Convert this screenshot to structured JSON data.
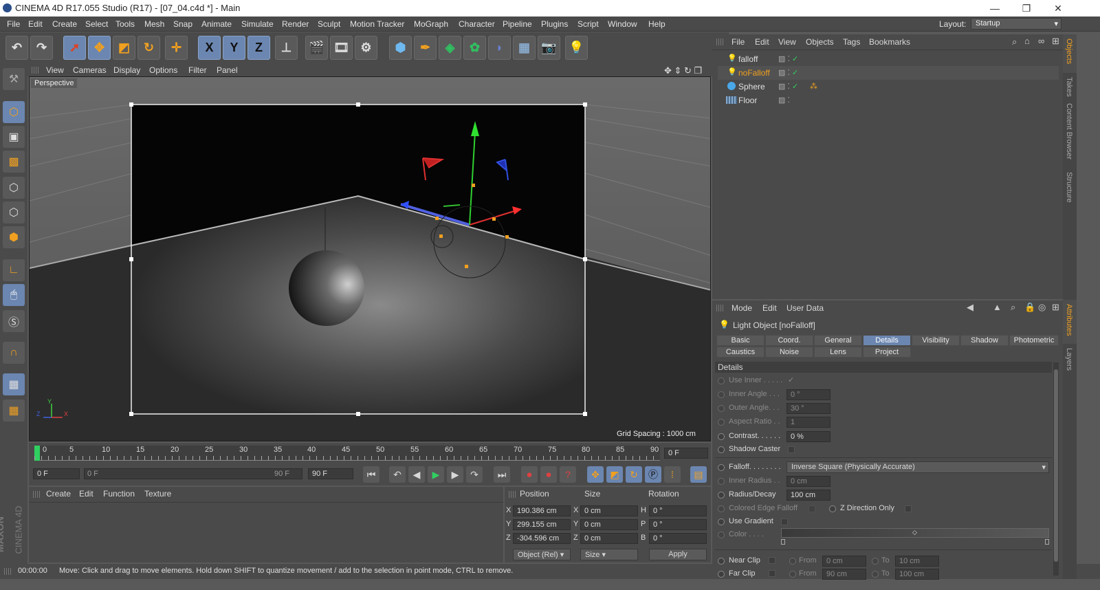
{
  "window": {
    "title": "CINEMA 4D R17.055 Studio (R17) - [07_04.c4d *] - Main",
    "min": "—",
    "restore": "❐",
    "close": "✕"
  },
  "menubar": [
    "File",
    "Edit",
    "Create",
    "Select",
    "Tools",
    "Mesh",
    "Snap",
    "Animate",
    "Simulate",
    "Render",
    "Sculpt",
    "Motion Tracker",
    "MoGraph",
    "Character",
    "Pipeline",
    "Plugins",
    "Script",
    "Window",
    "Help"
  ],
  "layout": {
    "label": "Layout:",
    "value": "Startup"
  },
  "toolbar": {
    "x_label": "X",
    "y_label": "Y",
    "z_label": "Z"
  },
  "viewport": {
    "menu": [
      "View",
      "Cameras",
      "Display",
      "Options",
      "Filter",
      "Panel"
    ],
    "name": "Perspective",
    "grid_spacing": "Grid Spacing : 1000 cm",
    "axes": {
      "x": "X",
      "y": "Y",
      "z": "Z"
    }
  },
  "timeline": {
    "ticks": [
      "0",
      "5",
      "10",
      "15",
      "20",
      "25",
      "30",
      "35",
      "40",
      "45",
      "50",
      "55",
      "60",
      "65",
      "70",
      "75",
      "80",
      "85",
      "90"
    ],
    "current_frame": "0 F",
    "start": "0 F",
    "slider_start": "0 F",
    "slider_end": "90 F",
    "end": "90 F"
  },
  "material_manager": {
    "menu": [
      "Create",
      "Edit",
      "Function",
      "Texture"
    ]
  },
  "coordinates": {
    "headers": {
      "position": "Position",
      "size": "Size",
      "rotation": "Rotation"
    },
    "rows": [
      {
        "axis": "X",
        "pos": "190.386 cm",
        "saxis": "X",
        "size": "0 cm",
        "raxis": "H",
        "rot": "0 °"
      },
      {
        "axis": "Y",
        "pos": "299.155 cm",
        "saxis": "Y",
        "size": "0 cm",
        "raxis": "P",
        "rot": "0 °"
      },
      {
        "axis": "Z",
        "pos": "-304.596 cm",
        "saxis": "Z",
        "size": "0 cm",
        "raxis": "B",
        "rot": "0 °"
      }
    ],
    "mode": "Object (Rel)",
    "size_mode": "Size",
    "apply": "Apply"
  },
  "status": {
    "time": "00:00:00",
    "message": "Move: Click and drag to move elements. Hold down SHIFT to quantize movement / add to the selection in point mode, CTRL to remove."
  },
  "branding": {
    "line1": "MAXON",
    "line2": "CINEMA 4D"
  },
  "object_manager": {
    "menu": [
      "File",
      "Edit",
      "View",
      "Objects",
      "Tags",
      "Bookmarks"
    ],
    "objects": [
      {
        "name": "falloff",
        "color": "#e0e0e0"
      },
      {
        "name": "noFalloff",
        "color": "#f0a020"
      },
      {
        "name": "Sphere",
        "color": "#e0e0e0"
      },
      {
        "name": "Floor",
        "color": "#e0e0e0"
      }
    ]
  },
  "right_tabs": {
    "objects": "Objects",
    "takes": "Takes",
    "content": "Content Browser",
    "structure": "Structure",
    "attributes": "Attributes",
    "layers": "Layers"
  },
  "attributes": {
    "menu": [
      "Mode",
      "Edit",
      "User Data"
    ],
    "object_title": "Light Object [noFalloff]",
    "tabs_row1": [
      "Basic",
      "Coord.",
      "General",
      "Details",
      "Visibility",
      "Shadow",
      "Photometric"
    ],
    "tabs_row2": [
      "Caustics",
      "Noise",
      "Lens",
      "Project"
    ],
    "section": "Details",
    "fields": {
      "use_inner": "Use Inner . . . . .",
      "use_inner_val": "✓",
      "inner_angle": "Inner Angle . . .",
      "inner_angle_val": "0 °",
      "outer_angle": "Outer Angle. . .",
      "outer_angle_val": "30 °",
      "aspect_ratio": "Aspect Ratio . .",
      "aspect_ratio_val": "1",
      "contrast": "Contrast. . . . . .",
      "contrast_val": "0 %",
      "shadow_caster": "Shadow Caster",
      "falloff": "Falloff. . . . . . . .",
      "falloff_val": "Inverse Square (Physically Accurate)",
      "inner_radius": "Inner Radius . .",
      "inner_radius_val": "0 cm",
      "radius_decay": "Radius/Decay",
      "radius_decay_val": "100 cm",
      "colored_edge": "Colored Edge Falloff",
      "z_direction": "Z Direction Only",
      "use_gradient": "Use Gradient",
      "color": "Color . . . .",
      "near_clip": "Near Clip",
      "near_from": "From",
      "near_from_val": "0 cm",
      "near_to": "To",
      "near_to_val": "10 cm",
      "far_clip": "Far Clip",
      "far_from": "From",
      "far_from_val": "90 cm",
      "far_to": "To",
      "far_to_val": "100 cm"
    }
  },
  "colors": {
    "accent": "#6b86b0",
    "selected_object": "#f0a020",
    "panel_bg": "#4a4a4a"
  }
}
